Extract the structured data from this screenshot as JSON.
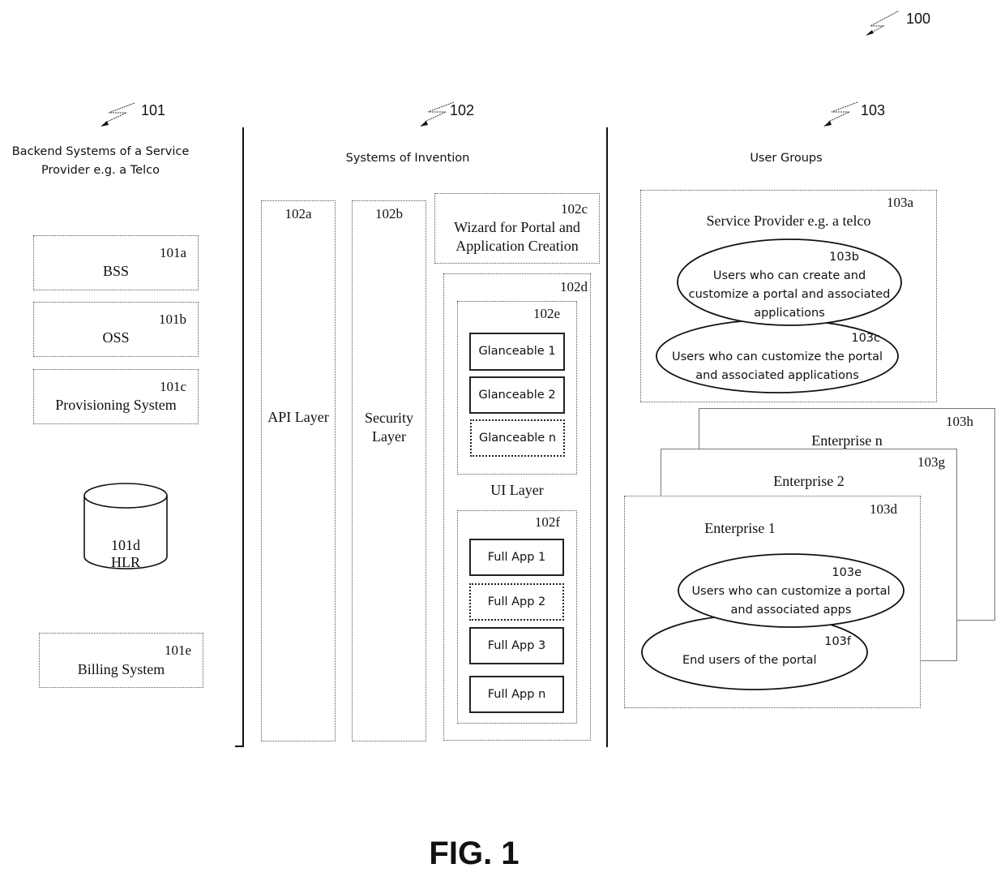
{
  "figure": {
    "ref": "100",
    "caption": "FIG. 1"
  },
  "columns": {
    "backend": {
      "ref": "101",
      "title_line1": "Backend Systems of a Service",
      "title_line2": "Provider e.g. a Telco",
      "items": [
        {
          "ref": "101a",
          "label": "BSS"
        },
        {
          "ref": "101b",
          "label": "OSS"
        },
        {
          "ref": "101c",
          "label": "Provisioning System"
        },
        {
          "ref": "101d",
          "label": "HLR",
          "shape": "database-cylinder"
        },
        {
          "ref": "101e",
          "label": "Billing System"
        }
      ]
    },
    "invention": {
      "ref": "102",
      "title": "Systems of Invention",
      "api_layer": {
        "ref": "102a",
        "label": "API Layer"
      },
      "security_layer": {
        "ref": "102b",
        "label_line1": "Security",
        "label_line2": "Layer"
      },
      "wizard": {
        "ref": "102c",
        "label_line1": "Wizard for Portal and",
        "label_line2": "Application Creation"
      },
      "ui_layer": {
        "ref": "102d",
        "label": "UI Layer",
        "glanceables": {
          "ref": "102e",
          "items": [
            "Glanceable 1",
            "Glanceable 2",
            "Glanceable n"
          ]
        },
        "full_apps": {
          "ref": "102f",
          "items": [
            "Full App 1",
            "Full App 2",
            "Full App 3",
            "Full App n"
          ]
        }
      }
    },
    "user_groups": {
      "ref": "103",
      "title": "User Groups",
      "service_provider": {
        "ref": "103a",
        "label": "Service Provider e.g. a telco",
        "groups": [
          {
            "ref": "103b",
            "line1": "Users who can create and",
            "line2": "customize a portal and associated",
            "line3": "applications"
          },
          {
            "ref": "103c",
            "line1": "Users who can customize the portal",
            "line2": "and associated applications"
          }
        ]
      },
      "enterprises": [
        {
          "ref": "103h",
          "label": "Enterprise n"
        },
        {
          "ref": "103g",
          "label": "Enterprise 2"
        },
        {
          "ref": "103d",
          "label": "Enterprise 1",
          "groups": [
            {
              "ref": "103e",
              "line1": "Users who can customize a portal",
              "line2": "and associated apps"
            },
            {
              "ref": "103f",
              "line1": "End users of the portal"
            }
          ]
        }
      ]
    }
  }
}
